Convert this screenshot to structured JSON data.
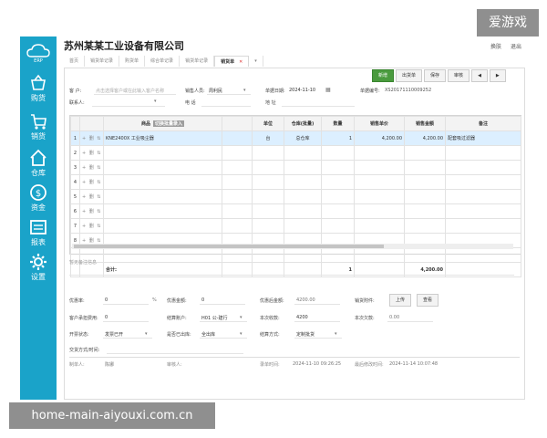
{
  "watermarks": {
    "top": "爱游戏",
    "bottom": "home-main-aiyouxi.com.cn"
  },
  "sidebar": {
    "logo_text": "ERP",
    "items": [
      {
        "label": "购货",
        "icon": "basket-icon"
      },
      {
        "label": "销货",
        "icon": "cart-icon"
      },
      {
        "label": "仓库",
        "icon": "home-icon"
      },
      {
        "label": "资金",
        "icon": "money-icon"
      },
      {
        "label": "报表",
        "icon": "report-icon"
      },
      {
        "label": "设置",
        "icon": "gear-icon"
      }
    ]
  },
  "header": {
    "company": "苏州某某工业设备有限公司",
    "links": [
      "换肤",
      "退出"
    ]
  },
  "tabs": [
    {
      "label": "首页"
    },
    {
      "label": "销货单记录"
    },
    {
      "label": "购货单"
    },
    {
      "label": "综合单记录"
    },
    {
      "label": "销货单记录"
    },
    {
      "label": "销货单",
      "active": true
    }
  ],
  "toolbar": {
    "new": "新增",
    "out": "出货单",
    "save": "保存",
    "audit": "审核",
    "prev": "◀",
    "next": "▶"
  },
  "form": {
    "customer_label": "客 户:",
    "customer_placeholder": "点击选择客户或在此输入客户名称",
    "salesperson_label": "销售人员:",
    "salesperson_value": "周利民",
    "date_label": "单据日期:",
    "date_value": "2024-11-10",
    "doc_no_label": "单据编号:",
    "doc_no_value": "XS20171110009252",
    "contact_label": "联系人:",
    "phone_label": "电 话",
    "address_label": "地 址"
  },
  "grid": {
    "headers": [
      "",
      "",
      "商品",
      "",
      "单位",
      "仓库(批量)",
      "数量",
      "销售单价",
      "销售金额",
      "备注"
    ],
    "batch_tag": "切换批量录入",
    "rows": [
      {
        "no": "1",
        "product": "KNE2400X 工业吸尘器",
        "unit": "台",
        "warehouse": "总仓库",
        "qty": "1",
        "price": "4,200.00",
        "amount": "4,200.00",
        "note": "配套吸过滤器"
      },
      {
        "no": "2"
      },
      {
        "no": "3"
      },
      {
        "no": "4"
      },
      {
        "no": "5"
      },
      {
        "no": "6"
      },
      {
        "no": "7"
      },
      {
        "no": "8"
      }
    ],
    "ops": "+ 删 ⇅",
    "total_label": "合计:",
    "total_qty": "1",
    "total_amount": "4,200.00"
  },
  "remark_placeholder": "暂无备注信息",
  "footer": {
    "discount_rate_label": "优惠率:",
    "discount_rate_value": "0",
    "percent": "%",
    "discount_amount_label": "优惠金额:",
    "discount_amount_value": "0",
    "after_discount_label": "优惠后金额:",
    "after_discount_value": "4200.00",
    "sale_bundle_label": "销货附件:",
    "upload": "上传",
    "view": "查看",
    "customer_fee_label": "客户承担费用:",
    "customer_fee_value": "0",
    "settle_account_label": "结算账户:",
    "settle_account_value": "H01 公-建行",
    "received_label": "本次收款:",
    "received_value": "4200",
    "debt_label": "本次欠款:",
    "debt_value": "0.00",
    "invoice_label": "开票状态:",
    "invoice_value": "发票已开",
    "shipped_label": "是否已出库:",
    "shipped_value": "全出库",
    "settle_method_label": "结算方式:",
    "settle_method_value": "定制批货",
    "trade_time_label": "交货方式/时间:",
    "maker_label": "制单人:",
    "maker_value": "陈娜",
    "auditor_label": "审核人:",
    "record_time_label": "录单时间:",
    "record_time_value": "2024-11-10 09:26:25",
    "modify_time_label": "最后修改时间:",
    "modify_time_value": "2024-11-14 10:07:48"
  }
}
